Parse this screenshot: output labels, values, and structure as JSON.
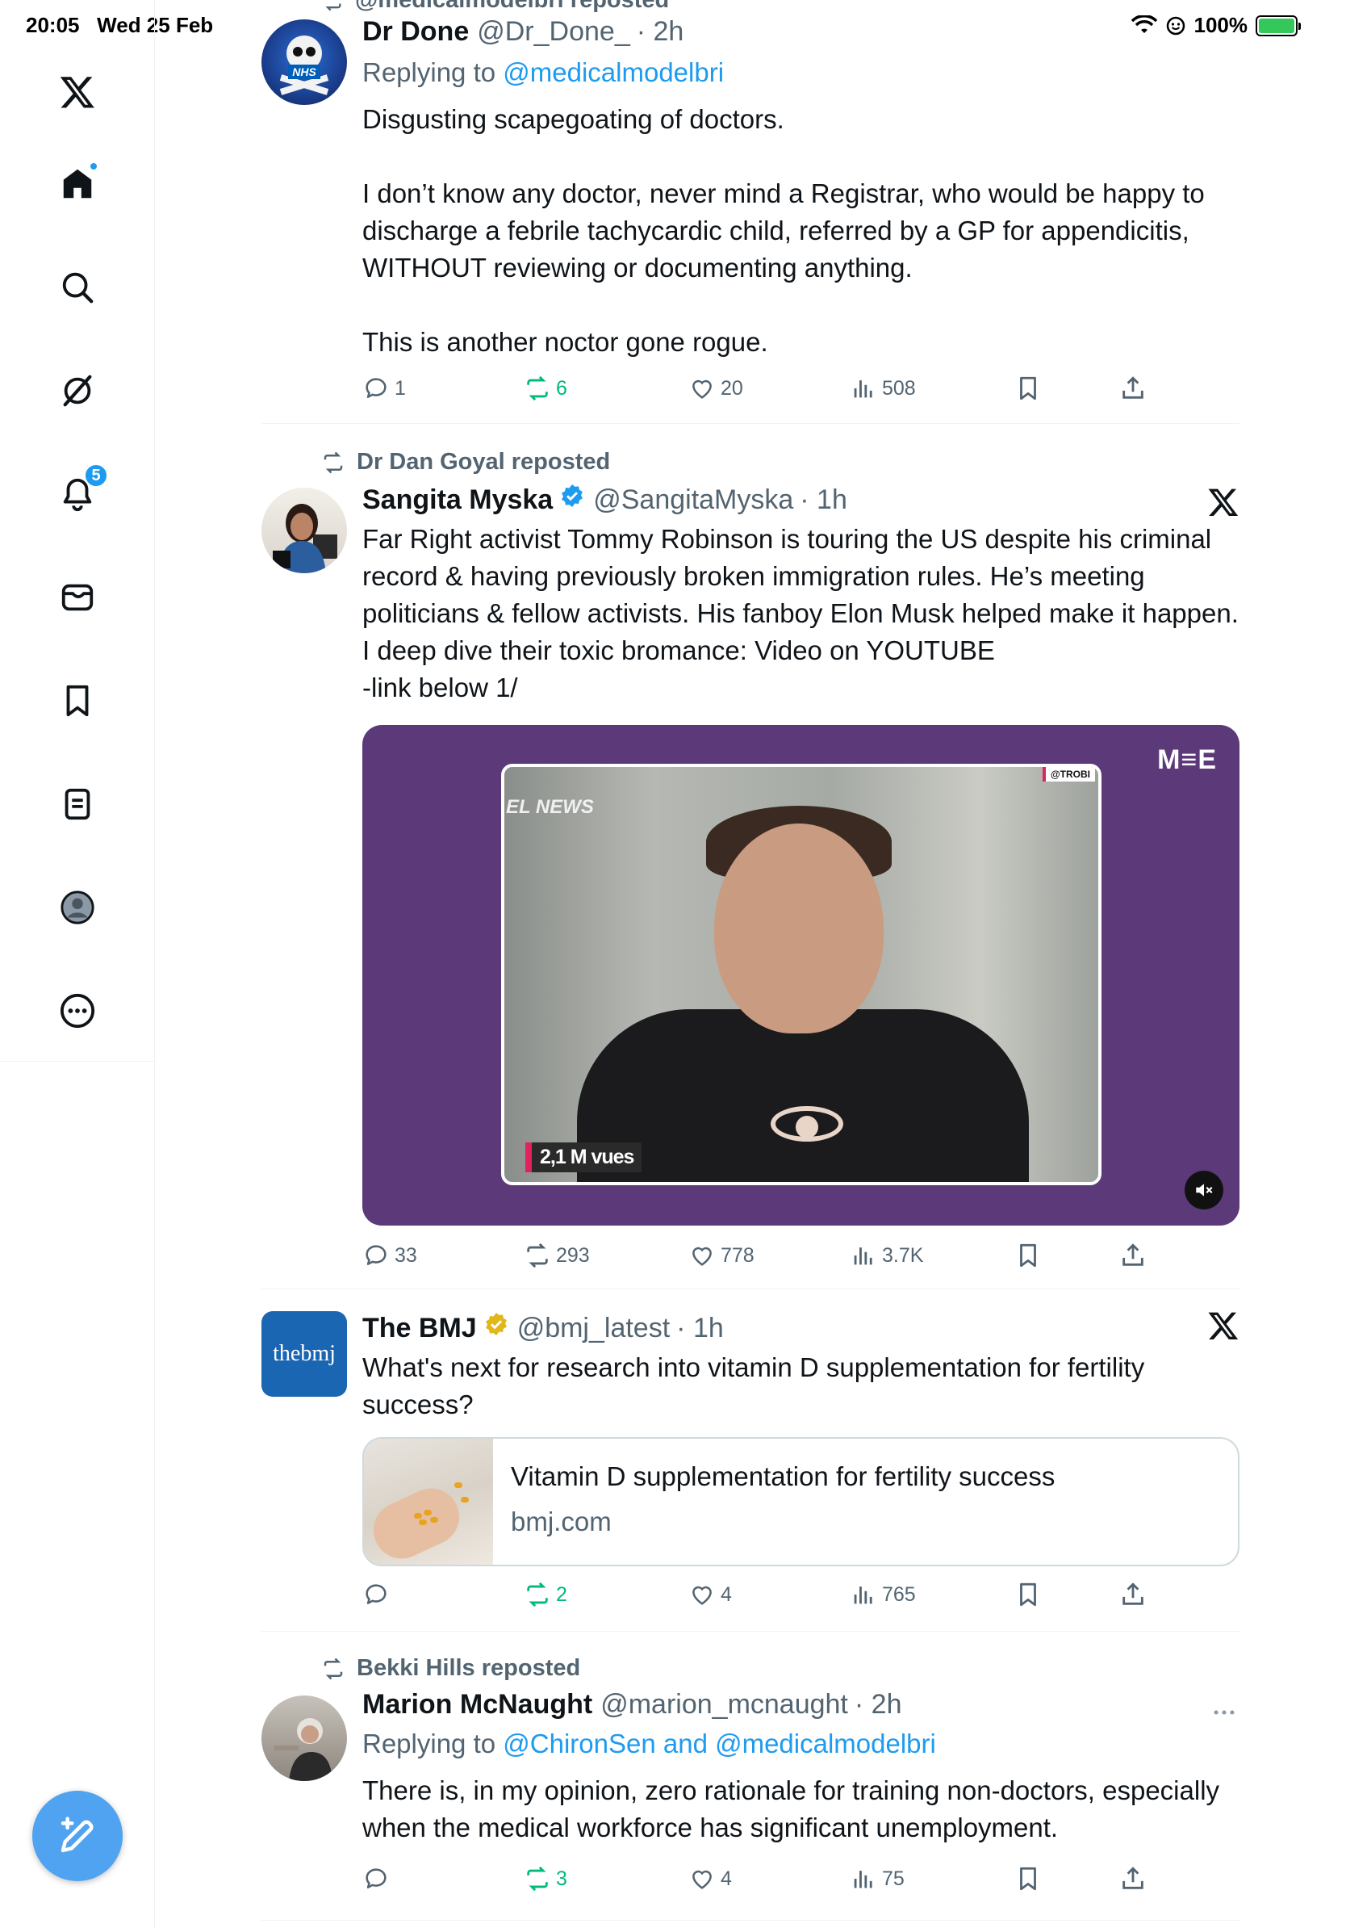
{
  "status_bar": {
    "time": "20:05",
    "date": "Wed 25 Feb",
    "battery": "100%"
  },
  "sidebar": {
    "notification_count": "5"
  },
  "tweets": [
    {
      "repost_label": "@medicalmodelbri reposted",
      "name": "Dr Done",
      "handle": "@Dr_Done_",
      "time": "· 2h",
      "reply_prefix": "Replying to ",
      "reply_to": "@medicalmodelbri",
      "text": "Disgusting scapegoating of doctors.\n\nI don’t know any doctor, never mind a Registrar, who would be happy to discharge a febrile tachycardic child, referred by a GP for appendicitis, WITHOUT reviewing or documenting anything.\n\nThis is another noctor gone rogue.",
      "replies": "1",
      "reposts": "6",
      "likes": "20",
      "views": "508"
    },
    {
      "repost_label": "Dr Dan Goyal reposted",
      "name": "Sangita Myska",
      "handle": "@SangitaMyska",
      "time": "· 1h",
      "text": "Far Right activist Tommy Robinson is touring the US despite his criminal record & having previously broken immigration rules. He’s meeting politicians & fellow activists. His fanboy Elon Musk helped make it happen. I deep dive their toxic bromance: Video on YOUTUBE\n-link below 1/",
      "media": {
        "views_overlay": "2,1 M vues",
        "brand": "M≡E",
        "news_label": "EL NEWS",
        "tag": "@TROBI"
      },
      "replies": "33",
      "reposts": "293",
      "likes": "778",
      "views": "3.7K"
    },
    {
      "name": "The BMJ",
      "handle": "@bmj_latest",
      "time": "· 1h",
      "avatar_text": "thebmj",
      "text": "What's next for research into vitamin D supplementation for fertility success?",
      "card": {
        "title": "Vitamin D supplementation for fertility success",
        "domain": "bmj.com"
      },
      "replies": "",
      "reposts": "2",
      "likes": "4",
      "views": "765"
    },
    {
      "repost_label": "Bekki Hills reposted",
      "name": "Marion McNaught",
      "handle": "@marion_mcnaught",
      "time": "· 2h",
      "reply_prefix": "Replying to ",
      "reply_to": "@ChironSen and @medicalmodelbri",
      "text": "There is, in my opinion, zero rationale for training non-doctors, especially when the medical workforce has significant unemployment.",
      "replies": "",
      "reposts": "3",
      "likes": "4",
      "views": "75"
    }
  ],
  "colors": {
    "accent": "#1d9bf0",
    "repost_green": "#00ba7c",
    "muted_text": "#536471",
    "media_bg": "#5c3a7a"
  }
}
